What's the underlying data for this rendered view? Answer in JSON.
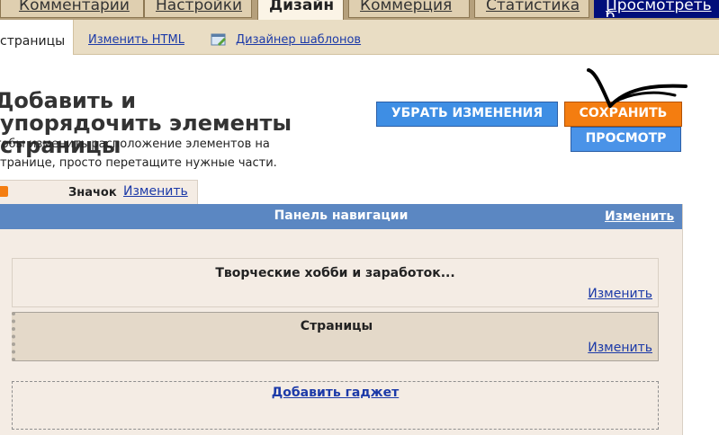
{
  "top_tabs": [
    "Комментарии",
    "Настройки",
    "Дизайн",
    "Коммерция",
    "Статистика",
    "Просмотреть б"
  ],
  "sub_tabs": {
    "active": "страницы",
    "edit_html": "Изменить HTML",
    "templates": "Дизайнер шаблонов"
  },
  "heading": "Добавить и упорядочить элементы страницы",
  "description": "тобы изменить расположение элементов на транице, просто перетащите нужные части.",
  "buttons": {
    "revert": "УБРАТЬ ИЗМЕНЕНИЯ",
    "save": "СОХРАНИТЬ",
    "preview": "ПРОСМОТР"
  },
  "favicon": {
    "label": "Значок",
    "edit": "Изменить"
  },
  "navbar": {
    "title": "Панель навигации",
    "edit": "Изменить"
  },
  "widgets": [
    {
      "title": "Творческие хобби и заработок...",
      "edit": "Изменить"
    },
    {
      "title": "Страницы",
      "edit": "Изменить"
    }
  ],
  "add_gadget": "Добавить гаджет",
  "colors": {
    "save": "#f47d10",
    "revert": "#3e8ee4",
    "navbar": "#5b87c2",
    "frame": "#f4ece4"
  }
}
